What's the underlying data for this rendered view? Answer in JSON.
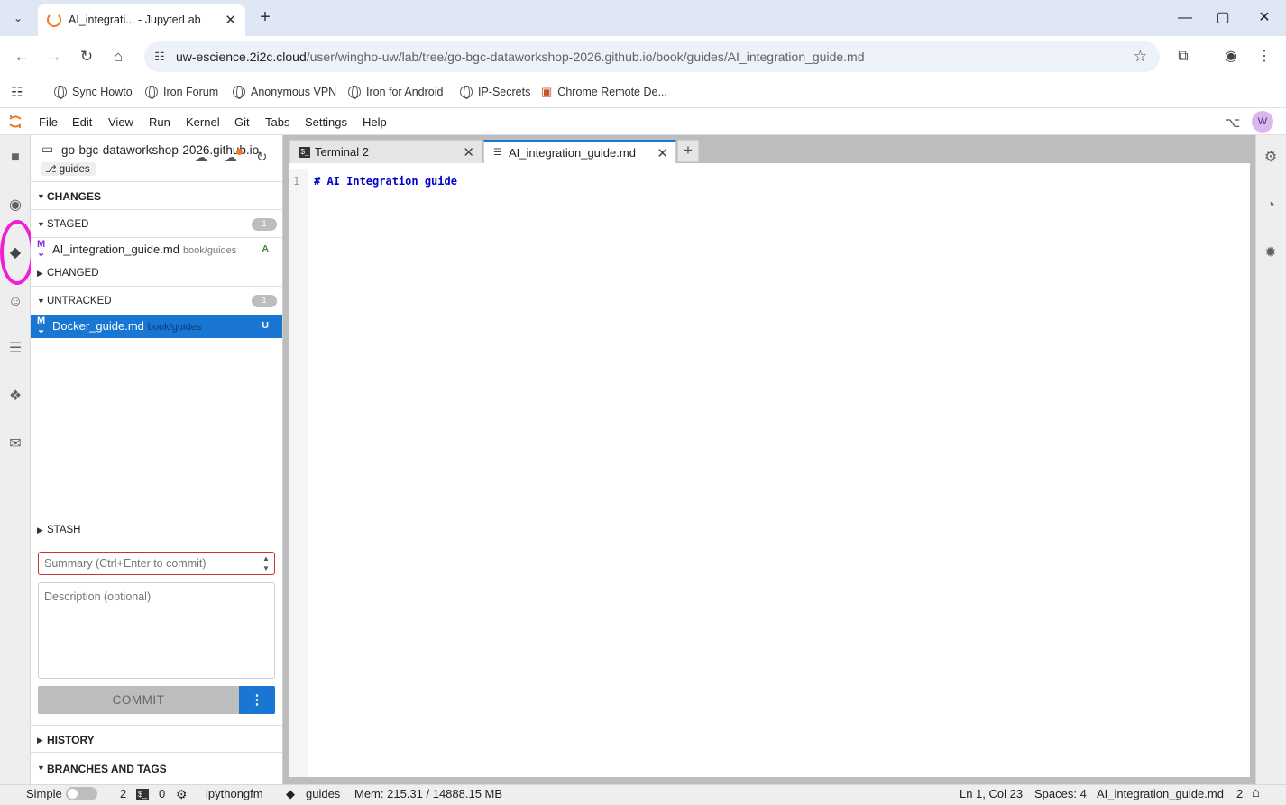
{
  "browser": {
    "tab_title": "AI_integrati... - JupyterLab",
    "url_host": "uw-escience.2i2c.cloud",
    "url_path": "/user/wingho-uw/lab/tree/go-bgc-dataworkshop-2026.github.io/book/guides/AI_integration_guide.md",
    "bookmarks": [
      "Sync Howto",
      "Iron Forum",
      "Anonymous VPN",
      "Iron for Android",
      "IP-Secrets",
      "Chrome Remote De..."
    ]
  },
  "menu": [
    "File",
    "Edit",
    "View",
    "Run",
    "Kernel",
    "Git",
    "Tabs",
    "Settings",
    "Help"
  ],
  "user_initial": "W",
  "git": {
    "repo_name": "go-bgc-dataworkshop-2026.github.io",
    "branch": "guides",
    "sections": {
      "changes": "CHANGES",
      "staged": "STAGED",
      "staged_count": "1",
      "changed": "CHANGED",
      "untracked": "UNTRACKED",
      "untracked_count": "1",
      "stash": "STASH",
      "history": "HISTORY",
      "branches_tags": "BRANCHES AND TAGS"
    },
    "staged_files": [
      {
        "name": "AI_integration_guide.md",
        "dir": "book/guides",
        "status": "A"
      }
    ],
    "untracked_files": [
      {
        "name": "Docker_guide.md",
        "dir": "book/guides",
        "status": "U"
      }
    ],
    "summary_placeholder": "Summary (Ctrl+Enter to commit)",
    "description_placeholder": "Description (optional)",
    "commit_label": "COMMIT"
  },
  "tabs": [
    {
      "label": "Terminal 2",
      "active": false
    },
    {
      "label": "AI_integration_guide.md",
      "active": true
    }
  ],
  "editor": {
    "line_number": "1",
    "code": "# AI Integration guide"
  },
  "status": {
    "simple_label": "Simple",
    "terminals_count": "2",
    "kernels_count": "0",
    "kernel_name": "ipythongfm",
    "branch": "guides",
    "memory": "Mem: 215.31 / 14888.15 MB",
    "cursor": "Ln 1, Col 23",
    "spaces": "Spaces: 4",
    "file_name": "AI_integration_guide.md",
    "notifications": "2"
  },
  "colors": {
    "accent": "#1976d2",
    "highlight_ring": "#f01fd4",
    "jupyter_orange": "#f37726"
  }
}
